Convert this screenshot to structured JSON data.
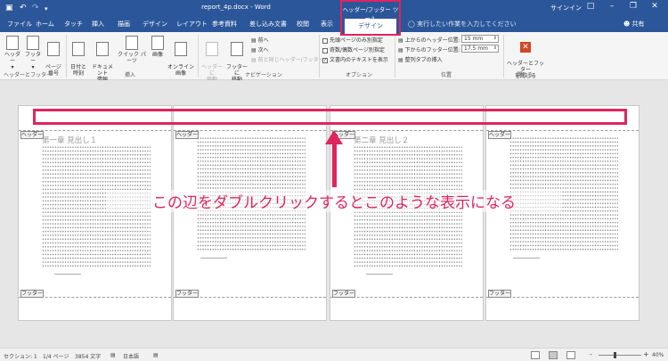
{
  "titlebar": {
    "save_icon": "save-icon",
    "undo_icon": "undo-icon",
    "redo_icon": "redo-icon",
    "qat_customize_icon": "dropdown-icon",
    "title": "report_4p.docx - Word",
    "signin": "サインイン",
    "ribbon_display_icon": "ribbon-display-icon",
    "minimize_icon": "minimize-icon",
    "restore_icon": "restore-icon",
    "close_icon": "close-icon"
  },
  "context_tools": {
    "label": "ヘッダー/フッター ツール",
    "tab": "デザイン"
  },
  "tabs": [
    "ファイル",
    "ホーム",
    "タッチ",
    "挿入",
    "描画",
    "デザイン",
    "レイアウト",
    "参考資料",
    "差し込み文書",
    "校閲",
    "表示"
  ],
  "tell_me": "実行したい作業を入力してください",
  "share": "共有",
  "ribbon": {
    "group1": {
      "label": "ヘッダーとフッター",
      "header": "ヘッダー",
      "footer": "フッター",
      "page_number": "ページ\n番号"
    },
    "group2": {
      "label": "挿入",
      "date_time": "日付と\n時刻",
      "doc_info": "ドキュメント\n情報",
      "quick_parts": "クイック パーツ",
      "picture": "画像",
      "online_picture": "オンライン\n画像"
    },
    "group3": {
      "label": "ナビゲーション",
      "goto_header": "ヘッダーに\n移動",
      "goto_footer": "フッターに\n移動",
      "previous": "前へ",
      "next": "次へ",
      "link_previous": "前と同じヘッダー/フッター"
    },
    "group4": {
      "label": "オプション",
      "different_first": "先頭ページのみ別指定",
      "different_odd_even": "奇数/偶数ページ別指定",
      "show_doc_text": "文書内のテキストを表示",
      "checked_mark": "✓"
    },
    "group5": {
      "label": "位置",
      "header_from_top": "上からのヘッダー位置:",
      "header_value": "15 mm",
      "footer_from_bottom": "下からのフッター位置:",
      "footer_value": "17.5 mm",
      "insert_alignment_tab": "整列タブの挿入"
    },
    "group6": {
      "label": "閉じる",
      "close": "ヘッダーとフッター\nを閉じる"
    }
  },
  "pages": [
    {
      "header_tag": "ヘッダー",
      "footer_tag": "フッター",
      "heading": "第一章 見出し１"
    },
    {
      "header_tag": "ヘッダー",
      "footer_tag": "フッター",
      "heading": ""
    },
    {
      "header_tag": "ヘッダー",
      "footer_tag": "フッター",
      "heading": "第二章 見出し２"
    },
    {
      "header_tag": "ヘッダー",
      "footer_tag": "フッター",
      "heading": ""
    }
  ],
  "annotation": "この辺をダブルクリックするとこのような表示になる",
  "status": {
    "section": "セクション: 1",
    "page": "1/4 ページ",
    "words": "3854 文字",
    "language": "日本語",
    "zoom_minus": "-",
    "zoom_plus": "+",
    "zoom": "40%",
    "zoom_value_percent": 40
  },
  "colors": {
    "word_blue": "#2b579a",
    "annotation_pink": "#e0245e"
  }
}
